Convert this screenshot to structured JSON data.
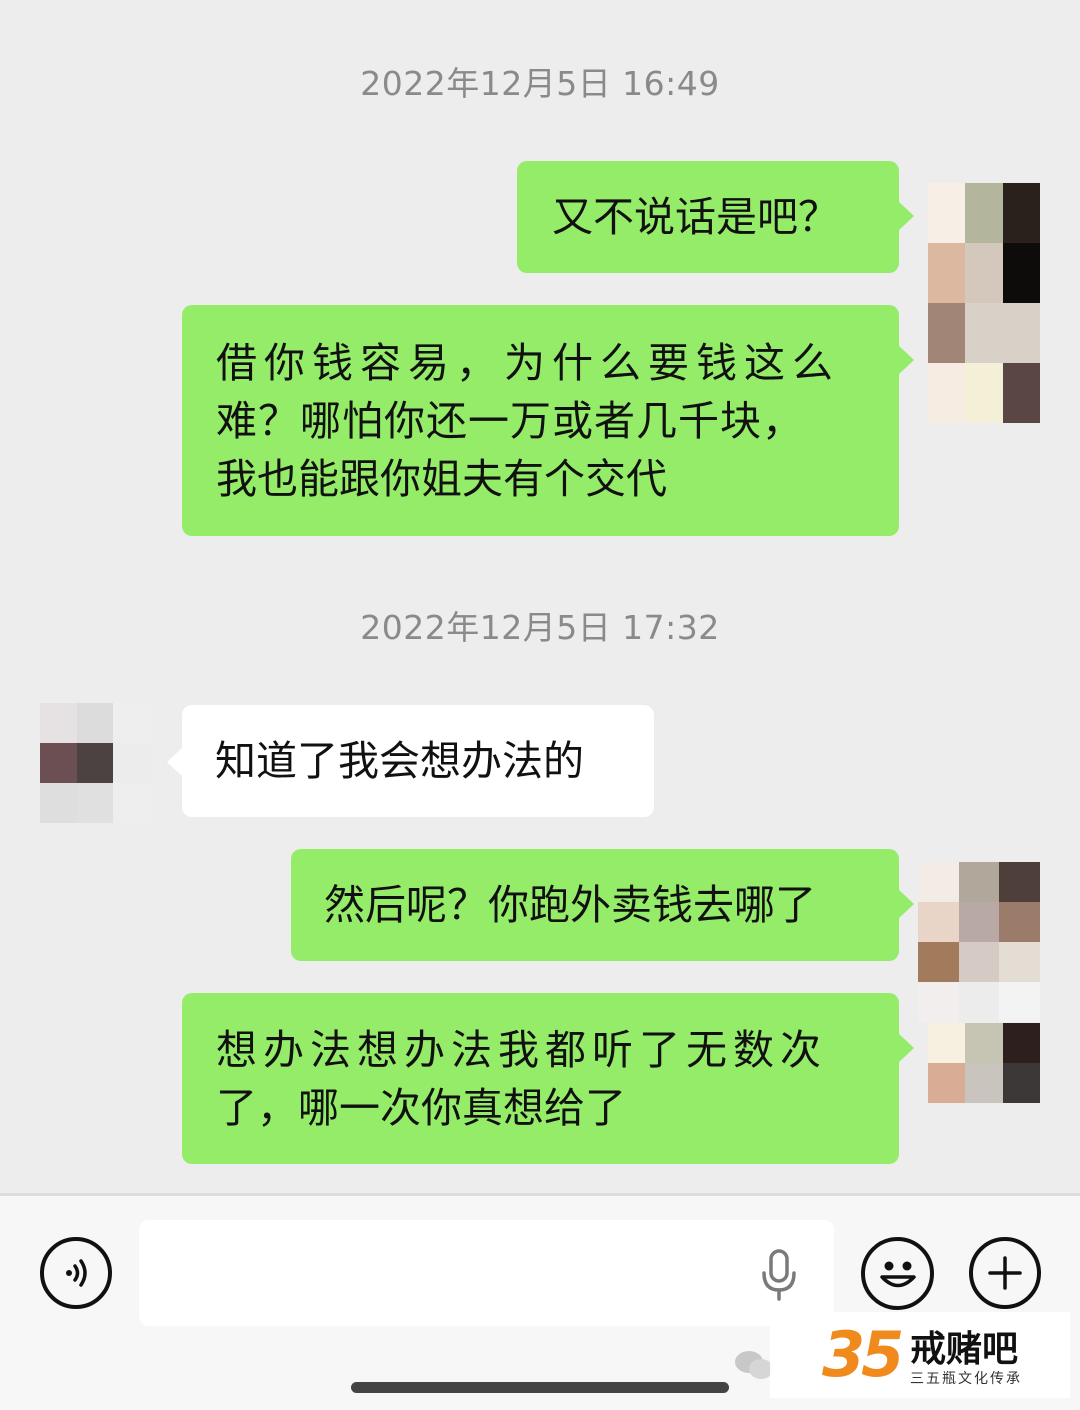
{
  "messages": {
    "ts1": "2022年12月5日 16:49",
    "m1": "又不说话是吧？",
    "m2_l1": "借你钱容易，为什么要钱这么",
    "m2_l2": "难？哪怕你还一万或者几千块，",
    "m2_l3": "我也能跟你姐夫有个交代",
    "ts2": "2022年12月5日 17:32",
    "m3": "知道了我会想办法的",
    "m4": "然后呢？你跑外卖钱去哪了",
    "m5_l1": "想办法想办法我都听了无数次",
    "m5_l2": "了，哪一次你真想给了"
  },
  "input_bar": {
    "voice_icon": "voice-icon",
    "mic_icon": "microphone-icon",
    "emoji_icon": "emoji-icon",
    "plus_icon": "plus-icon"
  },
  "watermark": {
    "number": "35",
    "title": "戒赌吧",
    "subtitle": "三五瓶文化传承"
  },
  "colors": {
    "sent_bubble": "#95ec69",
    "recv_bubble": "#ffffff",
    "background": "#ededed"
  }
}
